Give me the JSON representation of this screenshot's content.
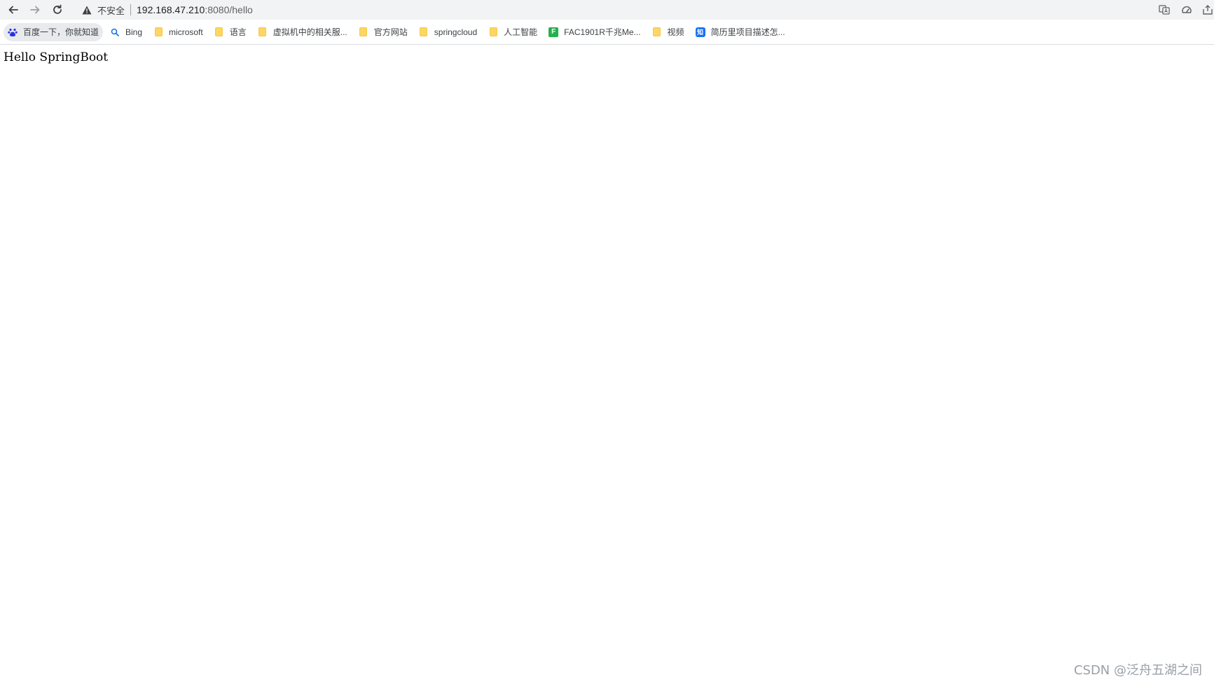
{
  "toolbar": {
    "insecure_label": "不安全",
    "url_host": "192.168.47.210",
    "url_path": ":8080/hello"
  },
  "bookmarks": [
    {
      "label": "百度一下，你就知道",
      "icon": "baidu-paw-icon"
    },
    {
      "label": "Bing",
      "icon": "search-icon"
    },
    {
      "label": "microsoft",
      "icon": "folder-icon"
    },
    {
      "label": "语言",
      "icon": "folder-icon"
    },
    {
      "label": "虚拟机中的相关服...",
      "icon": "folder-icon"
    },
    {
      "label": "官方网站",
      "icon": "folder-icon"
    },
    {
      "label": "springcloud",
      "icon": "folder-icon"
    },
    {
      "label": "人工智能",
      "icon": "folder-icon"
    },
    {
      "label": "FAC1901R千兆Me...",
      "icon": "green-f-icon",
      "icon_text": "F"
    },
    {
      "label": "视频",
      "icon": "folder-icon"
    },
    {
      "label": "简历里项目描述怎...",
      "icon": "zhihu-icon",
      "icon_text": "知"
    }
  ],
  "page": {
    "body_text": "Hello SpringBoot"
  },
  "watermark": {
    "text": "CSDN @泛舟五湖之间"
  },
  "colors": {
    "toolbar_bg": "#f1f3f4",
    "folder": "#fdd663",
    "green_icon": "#22b14c",
    "blue_icon": "#1772f6"
  }
}
